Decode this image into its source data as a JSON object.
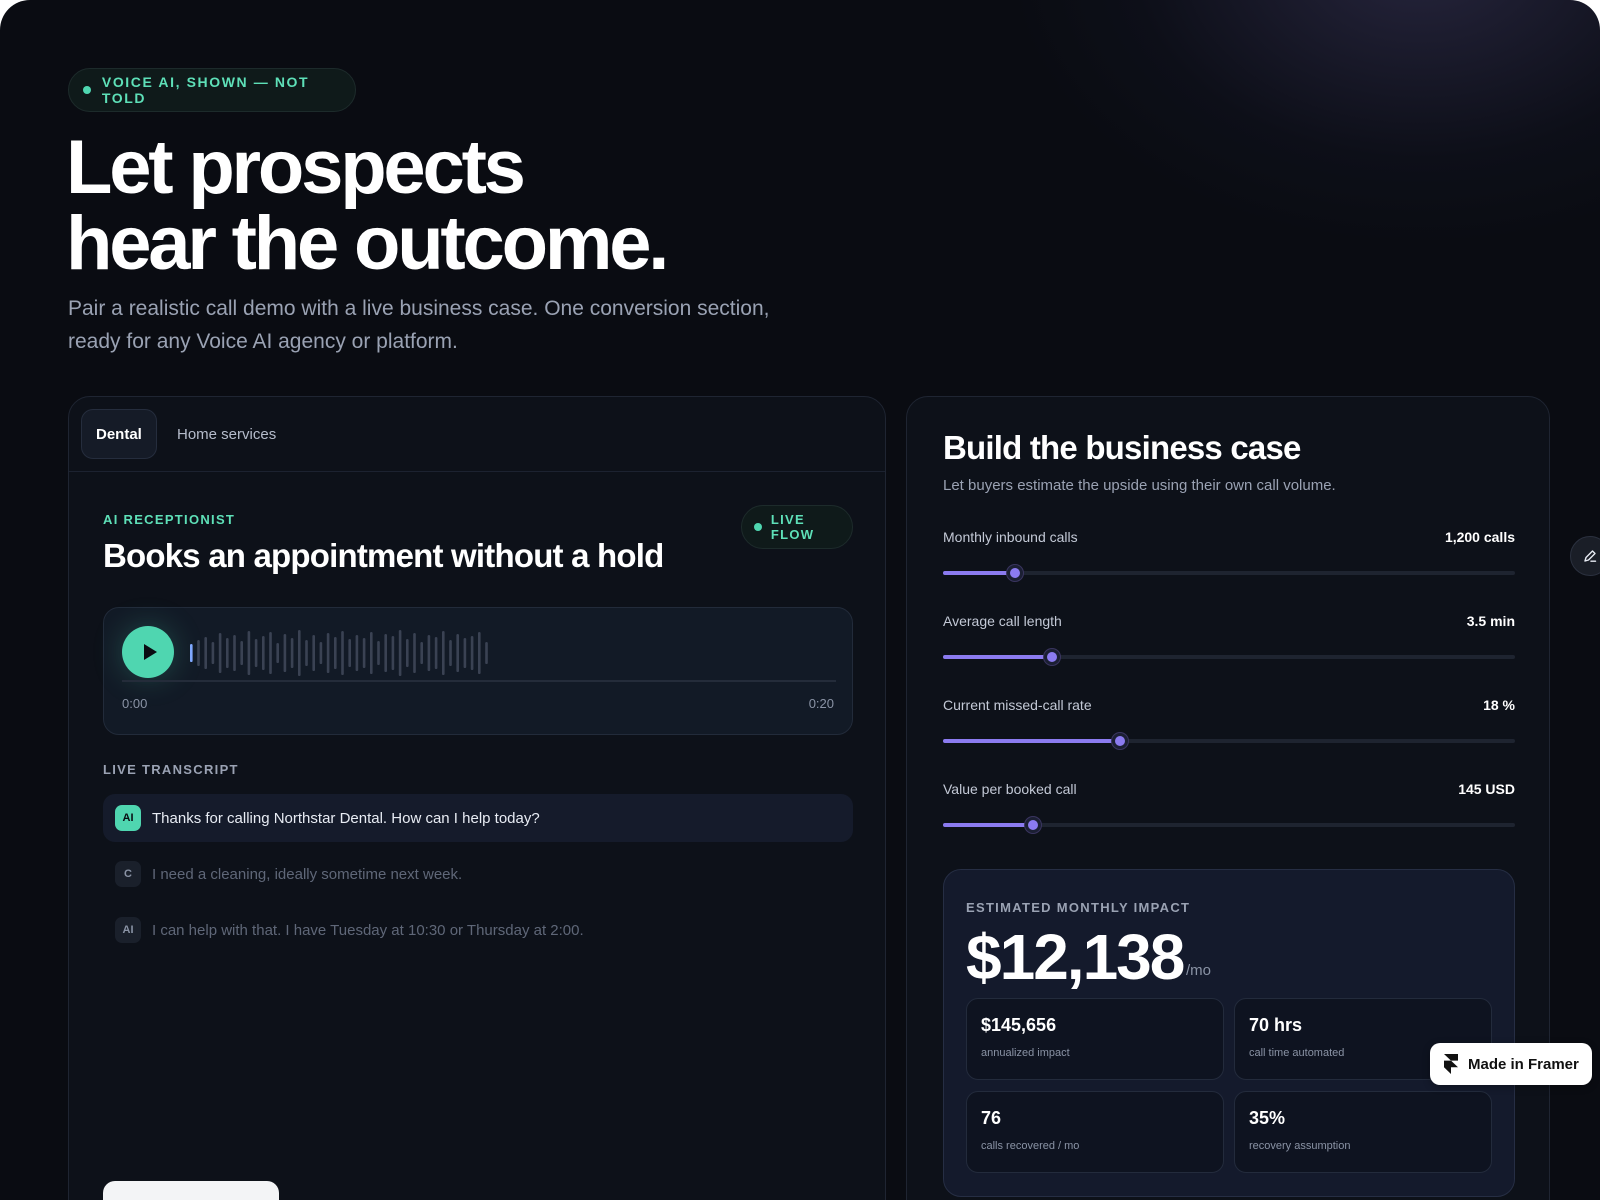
{
  "hero": {
    "pill": "VOICE AI, SHOWN — NOT TOLD",
    "title_line1": "Let prospects",
    "title_line2": "hear the outcome.",
    "subtitle_line1": "Pair a realistic call demo with a live business case. One conversion section,",
    "subtitle_line2": "ready for any Voice AI agency or platform."
  },
  "demo": {
    "tabs": [
      {
        "label": "Dental",
        "active": true
      },
      {
        "label": "Home services",
        "active": false
      }
    ],
    "eyebrow": "AI RECEPTIONIST",
    "live_badge": "LIVE FLOW",
    "title": "Books an appointment without a hold",
    "player": {
      "time_start": "0:00",
      "time_end": "0:20",
      "progress": 0.0
    },
    "transcript_label": "LIVE TRANSCRIPT",
    "transcript": [
      {
        "speaker": "AI",
        "text": "Thanks for calling Northstar Dental. How can I help today?",
        "active": true
      },
      {
        "speaker": "C",
        "text": "I need a cleaning, ideally sometime next week.",
        "active": false
      },
      {
        "speaker": "AI",
        "text": "I can help with that. I have Tuesday at 10:30 or Thursday at 2:00.",
        "active": false
      }
    ]
  },
  "business_case": {
    "title": "Build the business case",
    "subtitle": "Let buyers estimate the upside using their own call volume.",
    "sliders": [
      {
        "label": "Monthly inbound calls",
        "value": "1,200 calls",
        "fraction": 0.125
      },
      {
        "label": "Average call length",
        "value": "3.5 min",
        "fraction": 0.19
      },
      {
        "label": "Current missed-call rate",
        "value": "18 %",
        "fraction": 0.31
      },
      {
        "label": "Value per booked call",
        "value": "145 USD",
        "fraction": 0.158
      }
    ],
    "impact": {
      "label": "ESTIMATED MONTHLY IMPACT",
      "value": "$12,138",
      "unit": "/mo",
      "stats": [
        {
          "value": "$145,656",
          "label": "annualized impact"
        },
        {
          "value": "70 hrs",
          "label": "call time automated"
        },
        {
          "value": "76",
          "label": "calls recovered / mo"
        },
        {
          "value": "35%",
          "label": "recovery assumption"
        }
      ]
    }
  },
  "framer_badge": "Made in Framer",
  "colors": {
    "accent_green": "#4fd6b0",
    "accent_purple": "#8b7bf0",
    "background": "#0a0c12"
  }
}
